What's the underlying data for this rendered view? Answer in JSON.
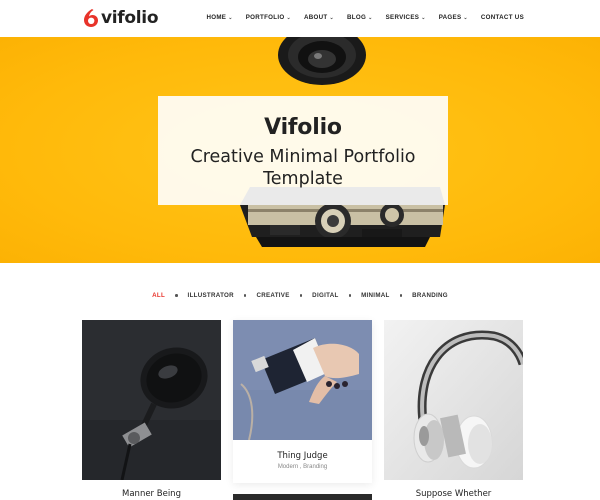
{
  "brand": {
    "name": "vifolio",
    "accent": "#e8332a"
  },
  "nav": [
    {
      "label": "HOME",
      "has_dropdown": true
    },
    {
      "label": "PORTFOLIO",
      "has_dropdown": true
    },
    {
      "label": "ABOUT",
      "has_dropdown": true
    },
    {
      "label": "BLOG",
      "has_dropdown": true
    },
    {
      "label": "SERVICES",
      "has_dropdown": true
    },
    {
      "label": "PAGES",
      "has_dropdown": true
    },
    {
      "label": "CONTACT US",
      "has_dropdown": false
    }
  ],
  "hero": {
    "title": "Vifolio",
    "subtitle_line1": "Creative Minimal Portfolio",
    "subtitle_line2": "Template",
    "background_color": "#ffbe0b"
  },
  "filters": {
    "items": [
      "ALL",
      "ILLUSTRATOR",
      "CREATIVE",
      "DIGITAL",
      "MINIMAL",
      "BRANDING"
    ],
    "active": "ALL"
  },
  "portfolio": [
    {
      "title": "Manner Being",
      "meta": ""
    },
    {
      "title": "Thing Judge",
      "meta": "Modern , Branding"
    },
    {
      "title": "Suppose Whether",
      "meta": ""
    }
  ]
}
